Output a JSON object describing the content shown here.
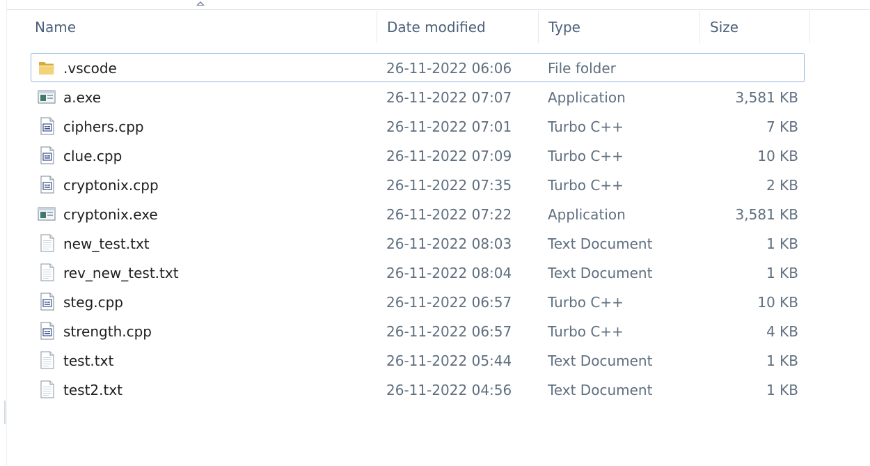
{
  "columns": {
    "name": "Name",
    "date": "Date modified",
    "type": "Type",
    "size": "Size",
    "sort_indicator": "chevron-up-icon"
  },
  "files": [
    {
      "name": ".vscode",
      "date": "26-11-2022 06:06",
      "type": "File folder",
      "size": "",
      "icon": "folder-icon"
    },
    {
      "name": "a.exe",
      "date": "26-11-2022 07:07",
      "type": "Application",
      "size": "3,581 KB",
      "icon": "application-icon"
    },
    {
      "name": "ciphers.cpp",
      "date": "26-11-2022 07:01",
      "type": "Turbo C++",
      "size": "7 KB",
      "icon": "cpp-file-icon"
    },
    {
      "name": "clue.cpp",
      "date": "26-11-2022 07:09",
      "type": "Turbo C++",
      "size": "10 KB",
      "icon": "cpp-file-icon"
    },
    {
      "name": "cryptonix.cpp",
      "date": "26-11-2022 07:35",
      "type": "Turbo C++",
      "size": "2 KB",
      "icon": "cpp-file-icon"
    },
    {
      "name": "cryptonix.exe",
      "date": "26-11-2022 07:22",
      "type": "Application",
      "size": "3,581 KB",
      "icon": "application-icon"
    },
    {
      "name": "new_test.txt",
      "date": "26-11-2022 08:03",
      "type": "Text Document",
      "size": "1 KB",
      "icon": "text-file-icon"
    },
    {
      "name": "rev_new_test.txt",
      "date": "26-11-2022 08:04",
      "type": "Text Document",
      "size": "1 KB",
      "icon": "text-file-icon"
    },
    {
      "name": "steg.cpp",
      "date": "26-11-2022 06:57",
      "type": "Turbo C++",
      "size": "10 KB",
      "icon": "cpp-file-icon"
    },
    {
      "name": "strength.cpp",
      "date": "26-11-2022 06:57",
      "type": "Turbo C++",
      "size": "4 KB",
      "icon": "cpp-file-icon"
    },
    {
      "name": "test.txt",
      "date": "26-11-2022 05:44",
      "type": "Text Document",
      "size": "1 KB",
      "icon": "text-file-icon"
    },
    {
      "name": "test2.txt",
      "date": "26-11-2022 04:56",
      "type": "Text Document",
      "size": "1 KB",
      "icon": "text-file-icon"
    }
  ],
  "colors": {
    "header_text": "#4c607a",
    "meta_text": "#5f6f80",
    "focus_border": "#8bb5dd",
    "folder": "#e9c25a"
  }
}
